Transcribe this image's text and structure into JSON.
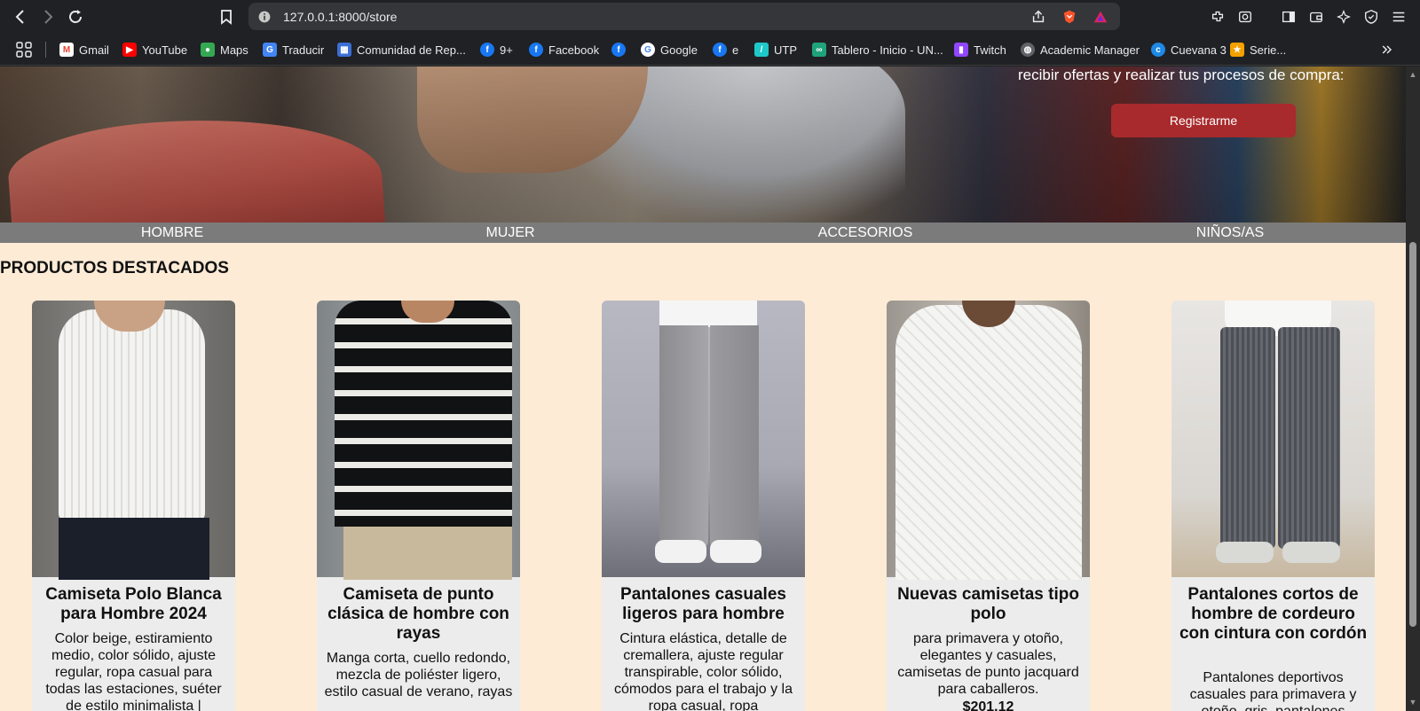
{
  "browser": {
    "url": "127.0.0.1:8000/store"
  },
  "bookmarks": [
    {
      "label": "Gmail",
      "icon": "gmail-icon",
      "color": "#ea4335"
    },
    {
      "label": "YouTube",
      "icon": "youtube-icon",
      "color": "#ff0000"
    },
    {
      "label": "Maps",
      "icon": "maps-icon",
      "color": "#34a853"
    },
    {
      "label": "Traducir",
      "icon": "translate-icon",
      "color": "#4285f4"
    },
    {
      "label": "Comunidad de Rep...",
      "icon": "calendar-icon",
      "color": "#3b6fd6"
    },
    {
      "label": "9+",
      "icon": "facebook-icon",
      "color": "#1877f2"
    },
    {
      "label": "Facebook",
      "icon": "facebook-icon",
      "color": "#1877f2"
    },
    {
      "label": "",
      "icon": "facebook-icon",
      "color": "#1877f2"
    },
    {
      "label": "Google",
      "icon": "google-icon",
      "color": "#ffffff"
    },
    {
      "label": "e",
      "icon": "facebook-icon",
      "color": "#1877f2"
    },
    {
      "label": "UTP",
      "icon": "utp-icon",
      "color": "#1ec8c8"
    },
    {
      "label": "Tablero - Inicio - UN...",
      "icon": "tablero-icon",
      "color": "#1fa37a"
    },
    {
      "label": "Twitch",
      "icon": "twitch-icon",
      "color": "#9146ff"
    },
    {
      "label": "Academic Manager",
      "icon": "globe-icon",
      "color": "#bdbdbd"
    },
    {
      "label": "Cuevana 3",
      "icon": "cuevana-icon",
      "color": "#1e88e5"
    },
    {
      "label": "Serie...",
      "icon": "star-icon",
      "color": "#f4a100"
    }
  ],
  "hero": {
    "text": "recibir ofertas y realizar tus procesos de compra:",
    "button": "Registrarme"
  },
  "categories": [
    "HOMBRE",
    "MUJER",
    "ACCESORIOS",
    "NIÑOS/AS"
  ],
  "section_title": "PRODUCTOS DESTACADOS",
  "products": [
    {
      "title": "Camiseta Polo Blanca para Hombre 2024",
      "description": "Color beige, estiramiento medio, color sólido, ajuste regular, ropa casual para todas las estaciones, suéter de estilo minimalista |"
    },
    {
      "title": "Camiseta de punto clásica de hombre con rayas",
      "description": "Manga corta, cuello redondo, mezcla de poliéster ligero, estilo casual de verano, rayas"
    },
    {
      "title": "Pantalones casuales ligeros para hombre",
      "description": "Cintura elástica, detalle de cremallera, ajuste regular transpirable, color sólido, cómodos para el trabajo y la ropa casual, ropa"
    },
    {
      "title": "Nuevas camisetas tipo polo",
      "description": "para primavera y otoño, elegantes y casuales, camisetas de punto jacquard para caballeros.",
      "price": "$201.12"
    },
    {
      "title": "Pantalones cortos de hombre de cordeuro con cintura con cordón",
      "description": "Pantalones deportivos casuales para primavera y otoño, gris, pantalones"
    }
  ]
}
